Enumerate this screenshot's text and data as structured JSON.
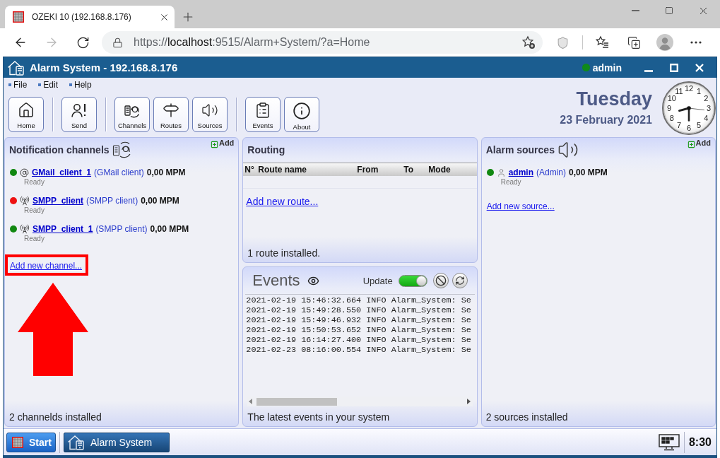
{
  "browser": {
    "tab": {
      "title": "OZEKI 10 (192.168.8.176)"
    },
    "nav": [
      {
        "kind": "back",
        "disabled": false
      },
      {
        "kind": "forward",
        "disabled": true
      },
      {
        "kind": "reload",
        "disabled": false
      }
    ],
    "address": {
      "scheme": "https://",
      "host": "localhost",
      "path": ":9515/Alarm+System/?a=Home"
    }
  },
  "app": {
    "title": "Alarm System - 192.168.8.176",
    "user": {
      "name": "admin",
      "online": true
    }
  },
  "menu": [
    {
      "label": "File"
    },
    {
      "label": "Edit"
    },
    {
      "label": "Help"
    }
  ],
  "toolbar": {
    "groups": [
      {
        "buttons": [
          {
            "kind": "home",
            "label": "Home"
          }
        ]
      },
      {
        "buttons": [
          {
            "kind": "send",
            "label": "Send"
          }
        ]
      },
      {
        "buttons": [
          {
            "kind": "channels",
            "label": "Channels"
          },
          {
            "kind": "routes",
            "label": "Routes"
          },
          {
            "kind": "sources",
            "label": "Sources"
          }
        ]
      },
      {
        "buttons": [
          {
            "kind": "events",
            "label": "Events"
          },
          {
            "kind": "about",
            "label": "About"
          }
        ]
      }
    ]
  },
  "date": {
    "weekday": "Tuesday",
    "date": "23 February 2021"
  },
  "clock": {
    "numerals": [
      "11",
      "12",
      "1",
      "10",
      "2",
      "9",
      "3",
      "8",
      "4",
      "7",
      "6",
      "5"
    ]
  },
  "notification_channels": {
    "title": "Notification channels",
    "add": "Add",
    "channels": [
      {
        "kind": "email",
        "color": "#118811",
        "name": "GMail_client_1",
        "type": "(GMail client)",
        "rate": "0,00 MPM",
        "status": "Ready"
      },
      {
        "kind": "antenna",
        "color": "#ee1111",
        "name": "SMPP_client",
        "type": "(SMPP client)",
        "rate": "0,00 MPM",
        "status": "Ready"
      },
      {
        "kind": "antenna",
        "color": "#118811",
        "name": "SMPP_client_1",
        "type": "(SMPP client)",
        "rate": "0,00 MPM",
        "status": "Ready"
      }
    ],
    "add_link": {
      "text": "Add new channel...",
      "highlighted": true
    },
    "footer": "2 channelds installed"
  },
  "routing": {
    "title": "Routing",
    "columns": [
      "N°",
      "Route name",
      "From",
      "To",
      "Mode"
    ],
    "add_link": {
      "text": "Add new route...",
      "highlighted": false
    },
    "footer": "1 route installed."
  },
  "events": {
    "title": "Events",
    "update": {
      "label": "Update",
      "on": true
    },
    "lines": [
      "2021-02-19 15:46:32.664 INFO Alarm_System: Se",
      "2021-02-19 15:49:28.550 INFO Alarm_System: Se",
      "2021-02-19 15:49:46.932 INFO Alarm_System: Se",
      "2021-02-19 15:50:53.652 INFO Alarm_System: Se",
      "2021-02-19 16:14:27.400 INFO Alarm_System: Se",
      "2021-02-23 08:16:00.554 INFO Alarm_System: Se"
    ],
    "footer": "The latest events in your system"
  },
  "alarm_sources": {
    "title": "Alarm sources",
    "add": "Add",
    "sources": [
      {
        "kind": "user",
        "color": "#118811",
        "name": "admin",
        "type": "(Admin)",
        "rate": "0,00 MPM",
        "status": "Ready"
      }
    ],
    "add_link": {
      "text": "Add new source...",
      "highlighted": false
    },
    "footer": "2 sources installed"
  },
  "taskbar": {
    "start": "Start",
    "tasks": [
      {
        "label": "Alarm System"
      }
    ],
    "time": "8:30"
  }
}
